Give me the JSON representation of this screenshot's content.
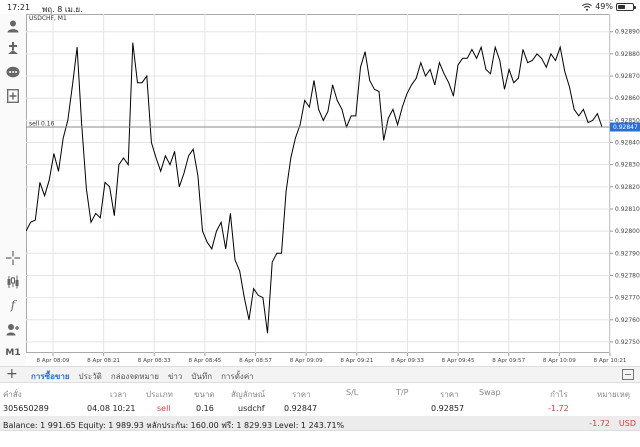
{
  "status_bar": {
    "time": "17:21",
    "date": "พฤ. 8 เม.ย.",
    "battery": "49%",
    "battery_level": 0.49
  },
  "chart": {
    "symbol_label": "USDCHF, M1",
    "sell_label": "sell 0.16",
    "bid_price": "0.92847",
    "background": "#ffffff",
    "line_color": "#000000",
    "grid_color": "#e4e4e4",
    "price_label_bg": "#2a6fd6",
    "y_tick_labels": [
      "0.92890",
      "0.92880",
      "0.92870",
      "0.92860",
      "0.92850",
      "0.92840",
      "0.92830",
      "0.92820",
      "0.92810",
      "0.92800",
      "0.92790",
      "0.92780",
      "0.92770",
      "0.92760",
      "0.92750"
    ],
    "x_tick_labels": [
      "8 Apr 08:09",
      "8 Apr 08:21",
      "8 Apr 08:33",
      "8 Apr 08:45",
      "8 Apr 08:57",
      "8 Apr 09:09",
      "8 Apr 09:21",
      "8 Apr 09:33",
      "8 Apr 09:45",
      "8 Apr 09:57",
      "8 Apr 10:09",
      "8 Apr 10:21"
    ]
  },
  "chart_data": {
    "type": "line",
    "title": "USDCHF, M1",
    "xlabel": "",
    "ylabel": "",
    "ylim": [
      0.92745,
      0.92898
    ],
    "grid": true,
    "series": [
      {
        "values": [
          0.928,
          0.92804,
          0.92805,
          0.92822,
          0.92816,
          0.92823,
          0.92835,
          0.92827,
          0.92842,
          0.9285,
          0.92866,
          0.92883,
          0.92848,
          0.92819,
          0.92804,
          0.92808,
          0.92806,
          0.92822,
          0.9282,
          0.92807,
          0.9283,
          0.92833,
          0.9283,
          0.92885,
          0.92867,
          0.92867,
          0.9287,
          0.9284,
          0.92833,
          0.92827,
          0.92834,
          0.9283,
          0.92836,
          0.9282,
          0.92826,
          0.92834,
          0.92837,
          0.92825,
          0.928,
          0.92795,
          0.92792,
          0.928,
          0.92804,
          0.92792,
          0.92808,
          0.92787,
          0.92782,
          0.9277,
          0.9276,
          0.92774,
          0.92771,
          0.9277,
          0.92754,
          0.92786,
          0.9279,
          0.9279,
          0.92818,
          0.92833,
          0.92842,
          0.92848,
          0.92859,
          0.92856,
          0.92868,
          0.92855,
          0.9285,
          0.92854,
          0.92866,
          0.92859,
          0.92855,
          0.92847,
          0.92852,
          0.92852,
          0.92874,
          0.92881,
          0.92868,
          0.92864,
          0.92863,
          0.92841,
          0.92851,
          0.92855,
          0.92848,
          0.92856,
          0.92862,
          0.92866,
          0.92869,
          0.92876,
          0.9287,
          0.92873,
          0.92866,
          0.92876,
          0.92871,
          0.92867,
          0.92861,
          0.92875,
          0.92878,
          0.92878,
          0.92882,
          0.92878,
          0.92883,
          0.92873,
          0.92871,
          0.92883,
          0.92877,
          0.92864,
          0.92873,
          0.92867,
          0.92869,
          0.92882,
          0.92876,
          0.92877,
          0.9288,
          0.92878,
          0.92874,
          0.9288,
          0.92877,
          0.92883,
          0.92872,
          0.92865,
          0.92855,
          0.92852,
          0.92855,
          0.92849,
          0.9285,
          0.92853,
          0.92847
        ]
      }
    ]
  },
  "toolbar": {
    "items": [
      "person-icon",
      "crosshair-add-icon",
      "chat-icon",
      "new-order-icon",
      "crosshair-icon",
      "indicators-icon",
      "function-icon",
      "objects-icon",
      "timeframe-label"
    ],
    "timeframe": "M1"
  },
  "bottom_tabs": [
    "การซื้อขาย",
    "ประวัติ",
    "กล่องจดหมาย",
    "ข่าว",
    "บันทึก",
    "การตั้งค่า"
  ],
  "table": {
    "headers": [
      "คำสั่ง",
      "เวลา",
      "ประเภท",
      "ขนาด",
      "สัญลักษณ์",
      "ราคา",
      "S/L",
      "T/P",
      "ราคา",
      "Swap",
      "กำไร",
      "หมายเหตุ"
    ],
    "rows": [
      {
        "order": "305650289",
        "time": "04.08 10:21",
        "type": "sell",
        "size": "0.16",
        "symbol": "usdchf",
        "price_open": "0.92847",
        "sl": "",
        "tp": "",
        "price_current": "0.92857",
        "swap": "",
        "profit": "-1.72",
        "comment": ""
      }
    ]
  },
  "balance_bar": {
    "text": "Balance: 1 991.65 Equity: 1 989.93 หลักประกัน: 160.00 ฟรี: 1 829.93 Level: 1 243.71%",
    "amount": "-1.72",
    "currency": "USD"
  }
}
